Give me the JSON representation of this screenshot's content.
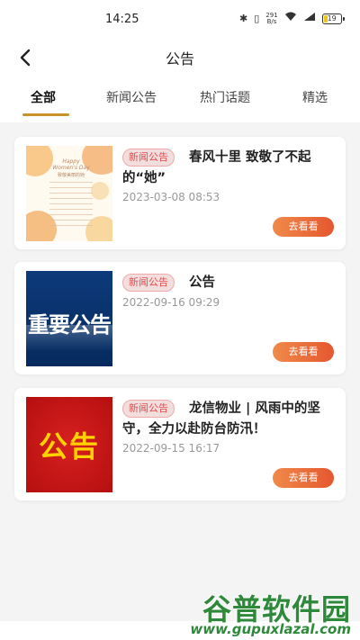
{
  "status": {
    "time": "14:25",
    "net_speed_top": "291",
    "net_speed_bottom": "B/s",
    "battery": "19"
  },
  "header": {
    "title": "公告"
  },
  "tabs": [
    {
      "label": "全部",
      "active": true
    },
    {
      "label": "新闻公告",
      "active": false
    },
    {
      "label": "热门话题",
      "active": false
    },
    {
      "label": "精选",
      "active": false
    }
  ],
  "articles": [
    {
      "badge": "新闻公告",
      "title": "春风十里 致敬了不起的“她”",
      "date": "2023-03-08 08:53",
      "button": "去看看",
      "thumb_text": [
        "Happy",
        "Women's Day",
        "致敬美丽的她"
      ]
    },
    {
      "badge": "新闻公告",
      "title": "公告",
      "date": "2022-09-16 09:29",
      "button": "去看看",
      "thumb_text": "重要公告"
    },
    {
      "badge": "新闻公告",
      "title": "龙信物业 | 风雨中的坚守，全力以赴防台防汛！",
      "date": "2022-09-15 16:17",
      "button": "去看看",
      "thumb_text": "公告"
    }
  ],
  "watermark": {
    "title": "谷普软件园",
    "url": "www.gupuxlazal.com"
  },
  "colors": {
    "accent": "#c8942a",
    "badge_text": "#e24b4b",
    "button": "#e5572f"
  }
}
